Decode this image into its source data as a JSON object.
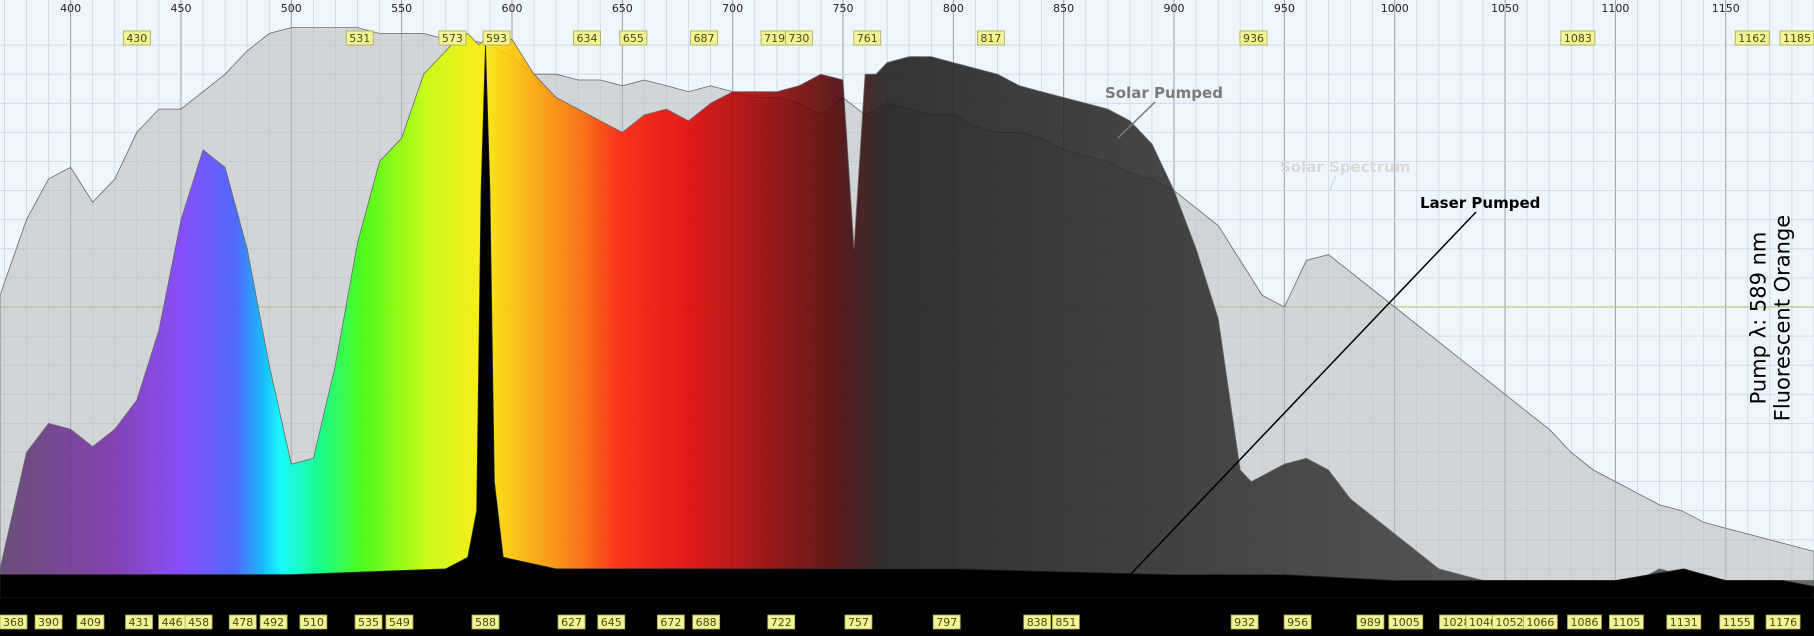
{
  "chart_data": {
    "type": "area",
    "xlim": [
      368,
      1190
    ],
    "ylim": [
      0,
      1
    ],
    "x_ticks": [
      400,
      450,
      500,
      550,
      600,
      650,
      700,
      750,
      800,
      850,
      900,
      950,
      1000,
      1050,
      1100,
      1150
    ],
    "top_peak_labels": [
      "430",
      "531",
      "573",
      "593",
      "634",
      "655",
      "687",
      "719",
      "730",
      "761",
      "817",
      "936",
      "1083",
      "1162",
      "1185"
    ],
    "bottom_peak_labels": [
      "368",
      "390",
      "409",
      "431",
      "446",
      "458",
      "478",
      "492",
      "510",
      "535",
      "549",
      "588",
      "627",
      "645",
      "672",
      "688",
      "722",
      "757",
      "797",
      "838",
      "851",
      "932",
      "956",
      "989",
      "1005",
      "1028",
      "1040",
      "1052",
      "1066",
      "1086",
      "1105",
      "1131",
      "1155",
      "1176"
    ],
    "series": [
      {
        "name": "Solar Spectrum",
        "x": [
          368,
          380,
          390,
          400,
          410,
          420,
          430,
          440,
          450,
          460,
          470,
          480,
          490,
          500,
          510,
          520,
          530,
          540,
          550,
          560,
          570,
          580,
          590,
          600,
          610,
          620,
          630,
          640,
          650,
          660,
          670,
          680,
          690,
          700,
          710,
          720,
          730,
          740,
          750,
          760,
          770,
          780,
          790,
          800,
          810,
          820,
          830,
          840,
          850,
          860,
          870,
          880,
          890,
          900,
          910,
          920,
          930,
          940,
          950,
          960,
          970,
          980,
          990,
          1000,
          1010,
          1020,
          1030,
          1040,
          1050,
          1060,
          1070,
          1080,
          1090,
          1100,
          1110,
          1120,
          1130,
          1140,
          1150,
          1160,
          1170,
          1180,
          1190
        ],
        "y": [
          0.52,
          0.65,
          0.72,
          0.74,
          0.68,
          0.72,
          0.8,
          0.84,
          0.84,
          0.87,
          0.9,
          0.94,
          0.97,
          0.98,
          0.98,
          0.98,
          0.98,
          0.97,
          0.97,
          0.97,
          0.96,
          0.96,
          0.95,
          0.93,
          0.9,
          0.9,
          0.89,
          0.89,
          0.88,
          0.89,
          0.88,
          0.87,
          0.88,
          0.87,
          0.86,
          0.86,
          0.85,
          0.83,
          0.86,
          0.83,
          0.85,
          0.84,
          0.83,
          0.83,
          0.81,
          0.8,
          0.8,
          0.79,
          0.77,
          0.76,
          0.75,
          0.73,
          0.72,
          0.7,
          0.67,
          0.64,
          0.58,
          0.52,
          0.5,
          0.58,
          0.59,
          0.56,
          0.53,
          0.5,
          0.47,
          0.44,
          0.41,
          0.38,
          0.35,
          0.32,
          0.29,
          0.25,
          0.22,
          0.2,
          0.18,
          0.16,
          0.15,
          0.13,
          0.12,
          0.11,
          0.1,
          0.09,
          0.08
        ]
      },
      {
        "name": "Solar Pumped",
        "x": [
          368,
          380,
          390,
          400,
          410,
          420,
          430,
          440,
          450,
          460,
          470,
          480,
          490,
          500,
          510,
          520,
          530,
          540,
          550,
          560,
          570,
          575,
          580,
          585,
          590,
          595,
          600,
          610,
          620,
          630,
          640,
          650,
          660,
          670,
          680,
          690,
          700,
          710,
          720,
          730,
          740,
          750,
          755,
          760,
          765,
          770,
          780,
          790,
          800,
          810,
          820,
          830,
          840,
          850,
          860,
          870,
          880,
          890,
          900,
          910,
          920,
          930,
          935,
          940,
          950,
          960,
          970,
          980,
          990,
          1000,
          1010,
          1020,
          1030,
          1040,
          1050,
          1060,
          1070,
          1080,
          1090,
          1100,
          1110,
          1120,
          1130,
          1140,
          1150,
          1160,
          1170,
          1180,
          1190
        ],
        "y": [
          0.05,
          0.25,
          0.3,
          0.29,
          0.26,
          0.29,
          0.34,
          0.46,
          0.65,
          0.77,
          0.74,
          0.6,
          0.4,
          0.23,
          0.24,
          0.4,
          0.61,
          0.75,
          0.79,
          0.9,
          0.94,
          0.96,
          0.97,
          0.95,
          0.97,
          0.96,
          0.96,
          0.9,
          0.86,
          0.84,
          0.82,
          0.8,
          0.83,
          0.84,
          0.82,
          0.85,
          0.87,
          0.87,
          0.87,
          0.88,
          0.9,
          0.89,
          0.6,
          0.9,
          0.9,
          0.92,
          0.93,
          0.93,
          0.92,
          0.91,
          0.9,
          0.88,
          0.87,
          0.86,
          0.85,
          0.84,
          0.82,
          0.78,
          0.7,
          0.6,
          0.48,
          0.22,
          0.2,
          0.21,
          0.23,
          0.24,
          0.22,
          0.17,
          0.14,
          0.11,
          0.08,
          0.05,
          0.04,
          0.03,
          0.03,
          0.03,
          0.03,
          0.03,
          0.03,
          0.03,
          0.03,
          0.05,
          0.04,
          0.03,
          0.03,
          0.03,
          0.03,
          0.03,
          0.03
        ]
      },
      {
        "name": "Laser Pumped",
        "x": [
          368,
          500,
          570,
          580,
          584,
          586,
          588,
          590,
          592,
          596,
          620,
          700,
          800,
          900,
          950,
          1000,
          1050,
          1100,
          1131,
          1150,
          1176,
          1190
        ],
        "y": [
          0.04,
          0.04,
          0.05,
          0.07,
          0.15,
          0.7,
          0.95,
          0.7,
          0.2,
          0.07,
          0.05,
          0.05,
          0.05,
          0.04,
          0.04,
          0.03,
          0.03,
          0.03,
          0.05,
          0.03,
          0.03,
          0.02
        ]
      }
    ],
    "annotations": [
      {
        "text": "Solar Pumped"
      },
      {
        "text": "Solar Spectrum"
      },
      {
        "text": "Laser Pumped"
      }
    ],
    "side_label_lines": [
      "Pump λ: 589 nm",
      "Fluorescent Orange"
    ],
    "colors": {
      "background": "#eef5fc",
      "grid_minor": "#c9d7e6",
      "grid_major": "#9a9fa6",
      "grid_horizontal": "#b5d36a",
      "label_box_fill": "#f4f398",
      "label_box_stroke": "#a5a84a",
      "solar_spectrum_fill": "#b9b9b9",
      "solar_pumped_fill": "#595959",
      "laser_fill": "#000000"
    }
  }
}
